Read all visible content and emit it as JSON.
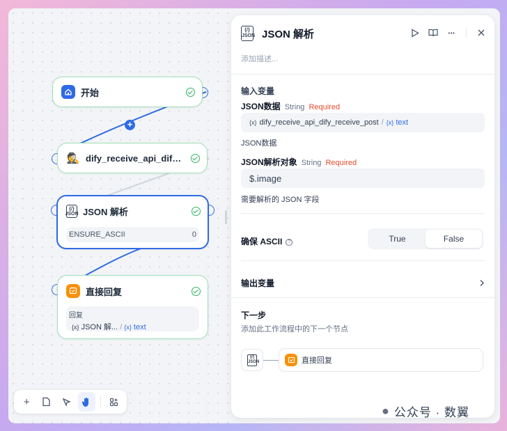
{
  "canvas": {
    "nodes": {
      "start": {
        "title": "开始",
        "icon": "home-icon"
      },
      "api": {
        "title": "dify_receive_api_dify_re...",
        "icon": "detective-icon"
      },
      "json": {
        "title": "JSON 解析",
        "icon": "json-icon",
        "param_label": "ENSURE_ASCII",
        "param_value": "0"
      },
      "reply": {
        "title": "直接回复",
        "icon": "reply-icon",
        "sub_label": "回复",
        "var_node": "JSON 解...",
        "var_sep": "/",
        "var_name": "text"
      }
    },
    "add_button": "+"
  },
  "toolbar": {
    "items": [
      "add-icon",
      "note-icon",
      "pointer-icon",
      "hand-icon",
      "organize-icon"
    ]
  },
  "panel": {
    "title": "JSON 解析",
    "description_placeholder": "添加描述...",
    "input_section": "输入变量",
    "field1": {
      "label": "JSON数据",
      "type": "String",
      "required": "Required",
      "var_prefix": "{x}",
      "var_node": "dify_receive_api_dify_receive_post",
      "var_sep": "/",
      "var_name": "text",
      "desc": "JSON数据"
    },
    "field2": {
      "label": "JSON解析对象",
      "type": "String",
      "required": "Required",
      "value": "$.image",
      "desc": "需要解析的 JSON 字段"
    },
    "ensure": {
      "label": "确保 ASCII",
      "options": [
        "True",
        "False"
      ],
      "selected": "False"
    },
    "output_section": "输出变量",
    "next": {
      "title": "下一步",
      "desc": "添加此工作流程中的下一个节点",
      "node": "直接回复"
    }
  },
  "watermark": "公众号 · 数翼",
  "colors": {
    "accent": "#2e6ae6",
    "success": "#2fb463",
    "required": "#e64a2e",
    "reply": "#f79009"
  }
}
